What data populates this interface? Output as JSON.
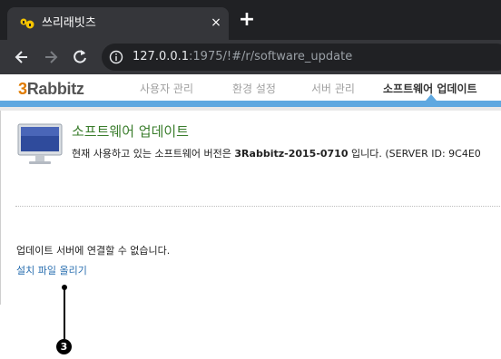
{
  "browser": {
    "tab_title": "쓰리래빗츠",
    "close_icon": "×",
    "new_tab_icon": "+",
    "url_host": "127.0.0.1",
    "url_rest": ":1975/!#/r/software_update"
  },
  "app": {
    "logo_number": "3",
    "logo_text": "Rabbitz",
    "nav": [
      {
        "label": "사용자 관리"
      },
      {
        "label": "환경 설정"
      },
      {
        "label": "서버 관리"
      },
      {
        "label": "소프트웨어 업데이트",
        "active": true
      }
    ],
    "accent_color": "#5fa8e0",
    "title_color": "#3a7d2c"
  },
  "main": {
    "title": "소프트웨어 업데이트",
    "version_prefix": "현재 사용하고 있는 소프트웨어 버전은 ",
    "version": "3Rabbitz-2015-0710",
    "version_suffix": " 입니다. (SERVER ID: 9C4E0",
    "message": "업데이트 서버에 연결할 수 없습니다.",
    "upload_link": "설치 파일 올리기"
  },
  "callout": {
    "number": "3"
  }
}
